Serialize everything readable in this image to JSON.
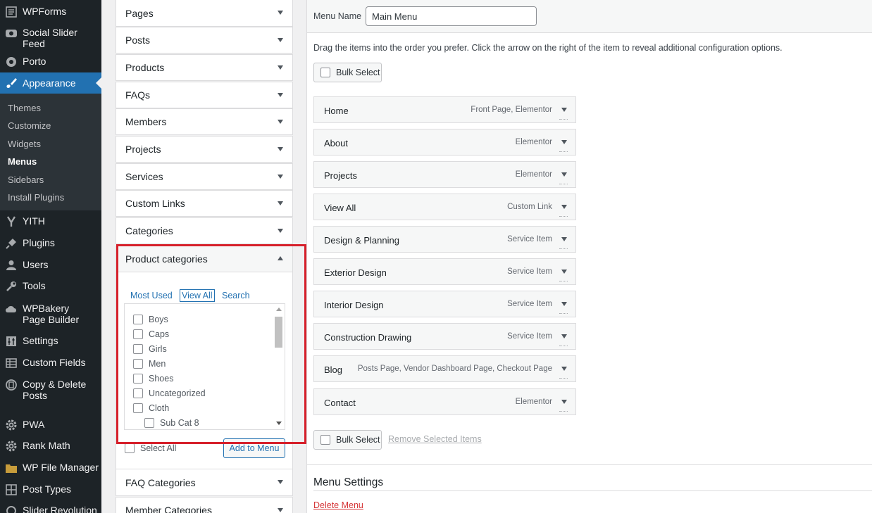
{
  "sidebar": {
    "items": [
      {
        "label": "WPForms",
        "icon": "forms-icon"
      },
      {
        "label": "Social Slider Feed",
        "icon": "camera-icon"
      },
      {
        "label": "Porto",
        "icon": "porto-icon"
      },
      {
        "label": "Appearance",
        "icon": "paintbrush-icon"
      },
      {
        "label": "YITH",
        "icon": "yith-icon"
      },
      {
        "label": "Plugins",
        "icon": "plug-icon"
      },
      {
        "label": "Users",
        "icon": "user-icon"
      },
      {
        "label": "Tools",
        "icon": "wrench-icon"
      },
      {
        "label": "WPBakery Page Builder",
        "icon": "cloud-icon"
      },
      {
        "label": "Settings",
        "icon": "sliders-icon"
      },
      {
        "label": "Custom Fields",
        "icon": "table-icon"
      },
      {
        "label": "Copy & Delete Posts",
        "icon": "copy-icon"
      },
      {
        "label": "PWA",
        "icon": "gear-icon"
      },
      {
        "label": "Rank Math",
        "icon": "gear-icon"
      },
      {
        "label": "WP File Manager",
        "icon": "folder-icon"
      },
      {
        "label": "Post Types",
        "icon": "grid-icon"
      },
      {
        "label": "Slider Revolution",
        "icon": "refresh-icon"
      }
    ],
    "submenu": [
      "Themes",
      "Customize",
      "Widgets",
      "Menus",
      "Sidebars",
      "Install Plugins"
    ]
  },
  "accordion": {
    "sections": [
      "Pages",
      "Posts",
      "Products",
      "FAQs",
      "Members",
      "Projects",
      "Services",
      "Custom Links",
      "Categories"
    ],
    "open_section": "Product categories",
    "tabs": [
      "Most Used",
      "View All",
      "Search"
    ],
    "categories": [
      "Boys",
      "Caps",
      "Girls",
      "Men",
      "Shoes",
      "Uncategorized",
      "Cloth"
    ],
    "child_category": "Sub Cat 8",
    "select_all": "Select All",
    "add_button": "Add to Menu",
    "after_sections": [
      "FAQ Categories",
      "Member Categories"
    ]
  },
  "menu": {
    "name_label": "Menu Name",
    "name_value": "Main Menu",
    "instructions": "Drag the items into the order you prefer. Click the arrow on the right of the item to reveal additional configuration options.",
    "bulk_select": "Bulk Select",
    "remove_selected": "Remove Selected Items",
    "items": [
      {
        "title": "Home",
        "type": "Front Page, Elementor"
      },
      {
        "title": "About",
        "type": "Elementor"
      },
      {
        "title": "Projects",
        "type": "Elementor"
      },
      {
        "title": "View All",
        "type": "Custom Link"
      },
      {
        "title": "Design & Planning",
        "type": "Service Item"
      },
      {
        "title": "Exterior Design",
        "type": "Service Item"
      },
      {
        "title": "Interior Design",
        "type": "Service Item"
      },
      {
        "title": "Construction Drawing",
        "type": "Service Item"
      },
      {
        "title": "Blog",
        "type": "Posts Page, Vendor Dashboard Page, Checkout Page"
      },
      {
        "title": "Contact",
        "type": "Elementor"
      }
    ],
    "settings_title": "Menu Settings",
    "delete_label": "Delete Menu"
  },
  "colors": {
    "sidebar_bg": "#1d2327",
    "accent": "#2271b1",
    "highlight_box": "#d6202b"
  }
}
